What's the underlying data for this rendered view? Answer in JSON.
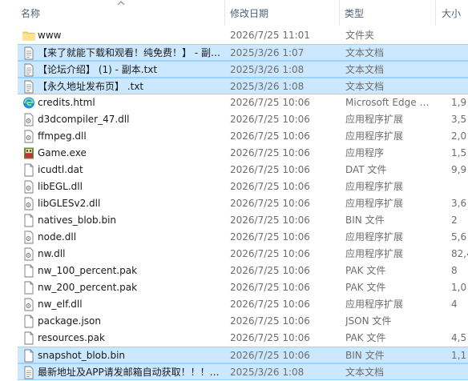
{
  "columns": {
    "name": "名称",
    "date": "修改日期",
    "type": "类型",
    "size": "大小"
  },
  "colors": {
    "selection": "#cce8ff",
    "selection_border": "#99d1ff",
    "header_text": "#4c607a",
    "meta_text": "#6d6d6d"
  },
  "files": [
    {
      "name": "www",
      "date": "2026/7/25 11:01",
      "type": "文件夹",
      "size": "",
      "icon": "folder-icon",
      "selected": false
    },
    {
      "name": "【来了就能下载和观看！纯免费！】 - 副…",
      "date": "2025/3/26 1:07",
      "type": "文本文档",
      "size": "",
      "icon": "text-file-icon",
      "selected": true
    },
    {
      "name": "【论坛介绍】 (1) - 副本.txt",
      "date": "2025/3/26 1:08",
      "type": "文本文档",
      "size": "",
      "icon": "text-file-icon",
      "selected": true
    },
    {
      "name": "【永久地址发布页】 .txt",
      "date": "2025/3/26 1:08",
      "type": "文本文档",
      "size": "",
      "icon": "text-file-icon",
      "selected": true
    },
    {
      "name": "credits.html",
      "date": "2026/7/25 10:06",
      "type": "Microsoft Edge …",
      "size": "1,9",
      "icon": "edge-icon",
      "selected": false
    },
    {
      "name": "d3dcompiler_47.dll",
      "date": "2026/7/25 10:06",
      "type": "应用程序扩展",
      "size": "3,5",
      "icon": "dll-file-icon",
      "selected": false
    },
    {
      "name": "ffmpeg.dll",
      "date": "2026/7/25 10:06",
      "type": "应用程序扩展",
      "size": "2,0",
      "icon": "dll-file-icon",
      "selected": false
    },
    {
      "name": "Game.exe",
      "date": "2026/7/25 10:06",
      "type": "应用程序",
      "size": "1,5",
      "icon": "game-exe-icon",
      "selected": false
    },
    {
      "name": "icudtl.dat",
      "date": "2026/7/25 10:06",
      "type": "DAT 文件",
      "size": "9,9",
      "icon": "file-icon",
      "selected": false
    },
    {
      "name": "libEGL.dll",
      "date": "2026/7/25 10:06",
      "type": "应用程序扩展",
      "size": "",
      "icon": "dll-file-icon",
      "selected": false
    },
    {
      "name": "libGLESv2.dll",
      "date": "2026/7/25 10:06",
      "type": "应用程序扩展",
      "size": "3,6",
      "icon": "dll-file-icon",
      "selected": false
    },
    {
      "name": "natives_blob.bin",
      "date": "2026/7/25 10:06",
      "type": "BIN 文件",
      "size": "2",
      "icon": "file-icon",
      "selected": false
    },
    {
      "name": "node.dll",
      "date": "2026/7/25 10:06",
      "type": "应用程序扩展",
      "size": "5,6",
      "icon": "dll-file-icon",
      "selected": false
    },
    {
      "name": "nw.dll",
      "date": "2026/7/25 10:06",
      "type": "应用程序扩展",
      "size": "82,4",
      "icon": "dll-file-icon",
      "selected": false
    },
    {
      "name": "nw_100_percent.pak",
      "date": "2026/7/25 10:06",
      "type": "PAK 文件",
      "size": "8",
      "icon": "file-icon",
      "selected": false
    },
    {
      "name": "nw_200_percent.pak",
      "date": "2026/7/25 10:06",
      "type": "PAK 文件",
      "size": "1,0",
      "icon": "file-icon",
      "selected": false
    },
    {
      "name": "nw_elf.dll",
      "date": "2026/7/25 10:06",
      "type": "应用程序扩展",
      "size": "4",
      "icon": "dll-file-icon",
      "selected": false
    },
    {
      "name": "package.json",
      "date": "2026/7/25 10:06",
      "type": "JSON 文件",
      "size": "",
      "icon": "file-icon",
      "selected": false
    },
    {
      "name": "resources.pak",
      "date": "2026/7/25 10:06",
      "type": "PAK 文件",
      "size": "4,5",
      "icon": "file-icon",
      "selected": false
    },
    {
      "name": "snapshot_blob.bin",
      "date": "2026/7/25 10:06",
      "type": "BIN 文件",
      "size": "1,1",
      "icon": "file-icon",
      "selected": true
    },
    {
      "name": "最新地址及APP请发邮箱自动获取！！！…",
      "date": "2025/3/26 1:08",
      "type": "文本文档",
      "size": "",
      "icon": "text-file-icon",
      "selected": true
    }
  ]
}
